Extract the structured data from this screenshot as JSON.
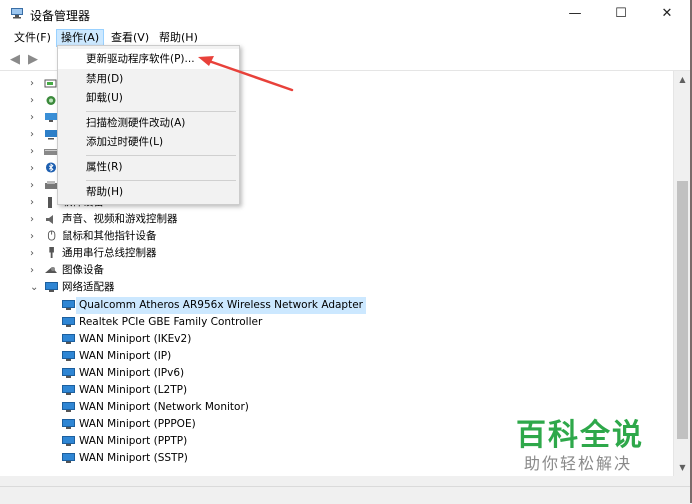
{
  "window": {
    "title": "设备管理器",
    "minimize": "—",
    "maximize": "☐",
    "close": "✕"
  },
  "menubar": {
    "items": [
      "文件(F)",
      "操作(A)",
      "查看(V)",
      "帮助(H)"
    ]
  },
  "dropdown": {
    "items": [
      "更新驱动程序软件(P)...",
      "禁用(D)",
      "卸载(U)",
      "扫描检测硬件改动(A)",
      "添加过时硬件(L)",
      "属性(R)",
      "帮助(H)"
    ]
  },
  "tree": {
    "categories": [
      "软件设备",
      "声音、视频和游戏控制器",
      "鼠标和其他指针设备",
      "通用串行总线控制器",
      "图像设备",
      "网络适配器"
    ],
    "adapters": [
      "Qualcomm Atheros AR956x Wireless Network Adapter",
      "Realtek PCIe GBE Family Controller",
      "WAN Miniport (IKEv2)",
      "WAN Miniport (IP)",
      "WAN Miniport (IPv6)",
      "WAN Miniport (L2TP)",
      "WAN Miniport (Network Monitor)",
      "WAN Miniport (PPPOE)",
      "WAN Miniport (PPTP)",
      "WAN Miniport (SSTP)"
    ]
  },
  "watermark": {
    "main": "百科全说",
    "sub": "助你轻松解决"
  },
  "colors": {
    "accent_highlight": "#cce8ff",
    "arrow": "#e8413a",
    "watermark_green": "#2ea84a"
  }
}
